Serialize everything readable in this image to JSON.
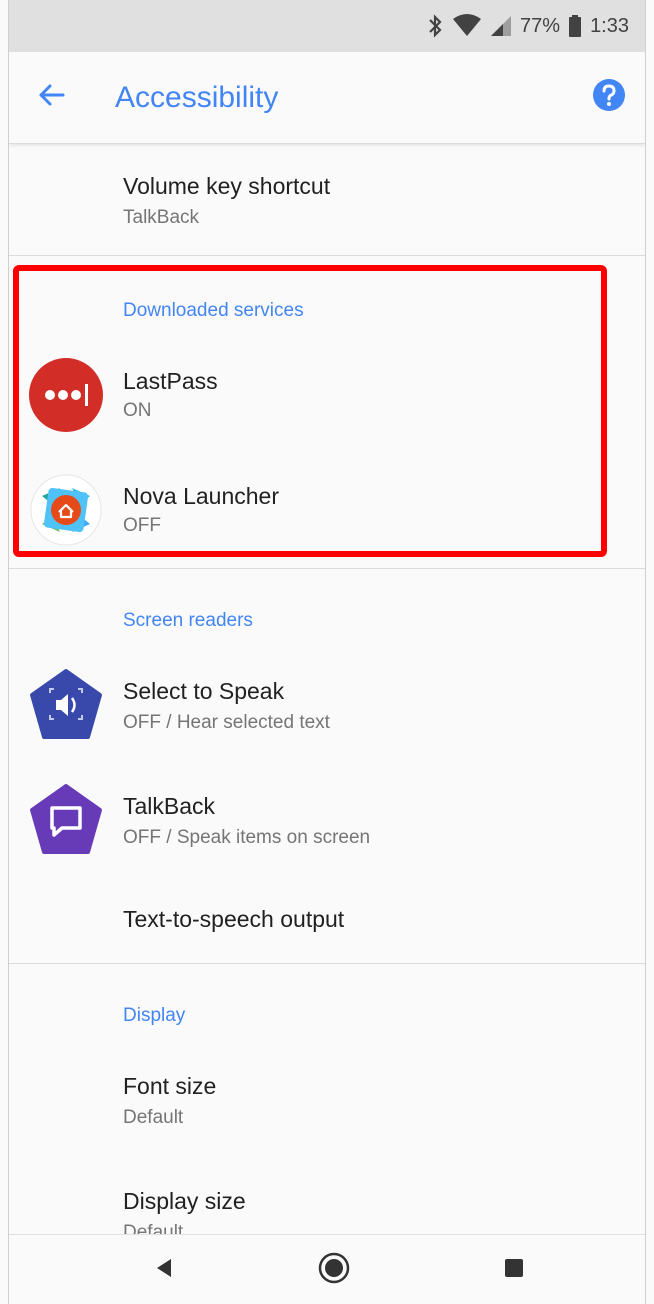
{
  "status_bar": {
    "battery_percent": "77%",
    "time": "1:33",
    "icons": [
      "bluetooth-icon",
      "wifi-icon",
      "cell-signal-icon",
      "battery-icon"
    ]
  },
  "app_bar": {
    "title": "Accessibility",
    "back_icon": "arrow-back-icon",
    "help_icon": "help-icon",
    "accent_color": "#4285f4"
  },
  "items": {
    "volume_key": {
      "title": "Volume key shortcut",
      "subtitle": "TalkBack"
    },
    "downloaded_header": "Downloaded services",
    "lastpass": {
      "title": "LastPass",
      "subtitle": "ON",
      "icon": "lastpass-icon"
    },
    "nova": {
      "title": "Nova Launcher",
      "subtitle": "OFF",
      "icon": "nova-launcher-icon"
    },
    "screen_readers_header": "Screen readers",
    "select_to_speak": {
      "title": "Select to Speak",
      "subtitle": "OFF / Hear selected text",
      "icon": "select-to-speak-icon"
    },
    "talkback": {
      "title": "TalkBack",
      "subtitle": "OFF / Speak items on screen",
      "icon": "talkback-icon"
    },
    "tts": {
      "title": "Text-to-speech output"
    },
    "display_header": "Display",
    "font_size": {
      "title": "Font size",
      "subtitle": "Default"
    },
    "display_size": {
      "title": "Display size",
      "subtitle": "Default"
    }
  },
  "nav_bar": {
    "back": "nav-back-icon",
    "home": "nav-home-icon",
    "recents": "nav-recents-icon"
  },
  "highlight_color": "#ff0000"
}
